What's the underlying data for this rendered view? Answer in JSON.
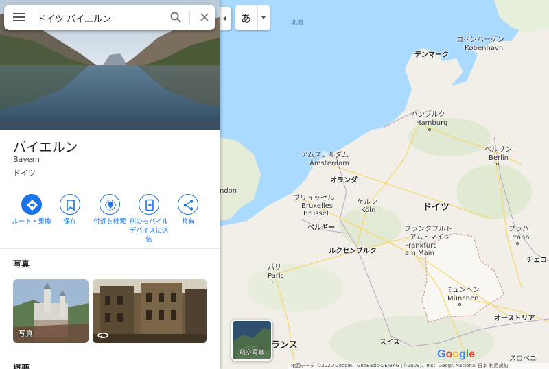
{
  "search": {
    "value": "ドイツ バイエルン"
  },
  "place": {
    "title": "バイエルン",
    "subtitle": "Bayern",
    "country": "ドイツ"
  },
  "actions": [
    {
      "label": "ルート・乗換",
      "icon": "directions-icon"
    },
    {
      "label": "保存",
      "icon": "bookmark-icon"
    },
    {
      "label": "付近を検索",
      "icon": "nearby-icon"
    },
    {
      "label": "別のモバイルデバイスに送信",
      "icon": "send-to-phone-icon"
    },
    {
      "label": "共有",
      "icon": "share-icon"
    }
  ],
  "photos": {
    "title": "写真",
    "items": [
      {
        "label": "写真"
      },
      {
        "label": ""
      }
    ]
  },
  "next_section": "概要",
  "map": {
    "labels": {
      "north_sea": "北海",
      "denmark": "デンマーク",
      "copenhagen_ja": "コペンハーゲン",
      "copenhagen": "København",
      "hamburg_ja": "ハンブルク",
      "hamburg": "Hamburg",
      "amsterdam_ja": "アムステルダム",
      "amsterdam": "Amsterdam",
      "berlin_ja": "ベルリン",
      "berlin": "Berlin",
      "london": "ndon",
      "netherlands": "オランダ",
      "brussels_ja": "ブリュッセル",
      "brussels_fr": "Bruxelles",
      "brussels_nl": "Brussel",
      "cologne_ja": "ケルン",
      "cologne": "Köln",
      "germany": "ドイツ",
      "belgium": "ベルギー",
      "frankfurt_ja_1": "フランクフルト",
      "frankfurt_ja_2": "アム・マイン",
      "frankfurt_1": "Frankfurt",
      "frankfurt_2": "am Main",
      "prague_ja": "プラハ",
      "prague": "Praha",
      "luxembourg": "ルクセンブルク",
      "paris_ja": "パリ",
      "paris": "Paris",
      "munich_ja": "ミュンヘン",
      "munich": "München",
      "czech": "チェコ",
      "austria": "オーストリア",
      "switzerland": "スイス",
      "france": "ランス",
      "slovenia": "スロベニ"
    },
    "satellite_label": "航空写真",
    "google_logo": "Google",
    "attribution": "地図データ ©2020 Google、GeoBasis-DE/BKG (©2009)、Inst. Geogr. Nacional   日本   利用規約",
    "ime_char": "あ"
  },
  "colors": {
    "water": "#aadaff",
    "land": "#f2efe9",
    "green": "#d4e6c5",
    "accent": "#1a73e8",
    "bavaria": "#f7f4ee",
    "border": "#c59aa8"
  }
}
